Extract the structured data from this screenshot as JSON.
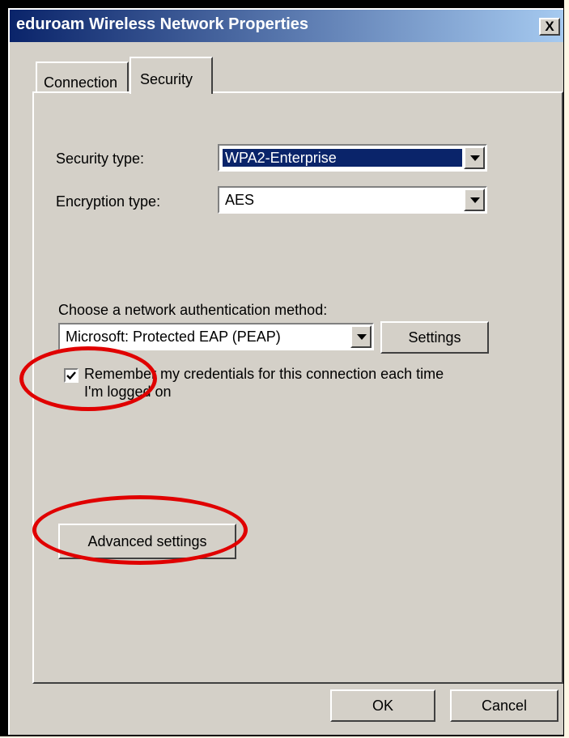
{
  "window": {
    "title": "eduroam Wireless Network Properties",
    "close_label": "X"
  },
  "tabs": [
    {
      "label": "Connection"
    },
    {
      "label": "Security"
    }
  ],
  "security": {
    "security_type_label": "Security type:",
    "security_type_value": "WPA2-Enterprise",
    "encryption_type_label": "Encryption type:",
    "encryption_type_value": "AES",
    "auth_method_label": "Choose a network authentication method:",
    "auth_method_value": "Microsoft: Protected EAP (PEAP)",
    "settings_button": "Settings",
    "remember_credentials_label": "Remember my credentials for this connection each time I'm logged on",
    "remember_credentials_checked": true,
    "advanced_settings_button": "Advanced settings"
  },
  "footer": {
    "ok_button": "OK",
    "cancel_button": "Cancel"
  },
  "annotation_color": "#e00000"
}
